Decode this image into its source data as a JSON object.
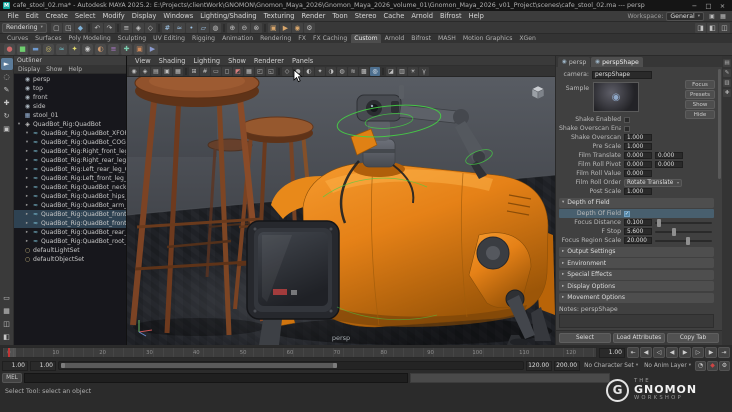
{
  "colors": {
    "accent": "#5285a6",
    "robot-orange": "#e58117",
    "control-green": "#45d145",
    "timeline-red": "#c03535"
  },
  "title_bar": {
    "title": "cafe_stool_02.ma* - Autodesk MAYA 2025.2: E:\\Projects\\clientWork\\GNOMON\\Gnomon_Maya_2026\\Gnomon_Maya_2026_volume_01\\Gnomon_Maya_2026_v01_Project\\scenes\\cafe_stool_02.ma --- persp",
    "maya_badge": "M",
    "minimize_glyph": "−",
    "maximize_glyph": "□",
    "close_glyph": "×"
  },
  "menu_bar": {
    "items": [
      "File",
      "Edit",
      "Create",
      "Select",
      "Modify",
      "Display",
      "Windows",
      "Lighting/Shading",
      "Texturing",
      "Render",
      "Toon",
      "Stereo",
      "Cache",
      "Arnold",
      "Bifrost",
      "Help"
    ],
    "workspace_label": "Workspace:",
    "workspace_value": "General",
    "caret": "▾",
    "right_icons": [
      {
        "name": "workspace-save-icon",
        "glyph": "▣"
      },
      {
        "name": "ui-layout-icon",
        "glyph": "▦"
      }
    ]
  },
  "status_line": {
    "menu_set": "Rendering",
    "caret": "▾",
    "icons": [
      {
        "name": "new-scene-icon",
        "glyph": "▢"
      },
      {
        "name": "open-scene-icon",
        "glyph": "◳"
      },
      {
        "name": "save-scene-icon",
        "glyph": "◆",
        "style": "color:#7fb2d9"
      },
      {
        "name": "status-divider",
        "glyph": "",
        "inter": "false",
        "style": "min-width:2px;width:2px;height:8px;background:#2d2d2d;border-radius:0;margin:0 1px"
      },
      {
        "name": "undo-icon",
        "glyph": "↶"
      },
      {
        "name": "redo-icon",
        "glyph": "↷"
      },
      {
        "name": "status-divider",
        "glyph": "",
        "inter": "false",
        "style": "min-width:2px;width:2px;height:8px;background:#2d2d2d;border-radius:0;margin:0 1px"
      },
      {
        "name": "select-hierarchy-icon",
        "glyph": "≡"
      },
      {
        "name": "select-object-icon",
        "glyph": "◈"
      },
      {
        "name": "select-component-icon",
        "glyph": "◇"
      },
      {
        "name": "status-divider",
        "glyph": "",
        "inter": "false",
        "style": "min-width:2px;width:2px;height:8px;background:#2d2d2d;border-radius:0;margin:0 1px"
      },
      {
        "name": "snap-grid-icon",
        "glyph": "#",
        "style": "color:#9fc5e8"
      },
      {
        "name": "snap-curve-icon",
        "glyph": "≈",
        "style": "color:#9fc5e8"
      },
      {
        "name": "snap-point-icon",
        "glyph": "•",
        "style": "color:#9fc5e8"
      },
      {
        "name": "snap-plane-icon",
        "glyph": "▱",
        "style": "color:#9fc5e8"
      },
      {
        "name": "make-live-icon",
        "glyph": "◍"
      },
      {
        "name": "status-divider",
        "glyph": "",
        "inter": "false",
        "style": "min-width:2px;width:2px;height:8px;background:#2d2d2d;border-radius:0;margin:0 1px"
      },
      {
        "name": "input-connections-icon",
        "glyph": "⊕"
      },
      {
        "name": "output-connections-icon",
        "glyph": "⊖"
      },
      {
        "name": "construction-history-icon",
        "glyph": "⊗"
      },
      {
        "name": "status-divider",
        "glyph": "",
        "inter": "false",
        "style": "min-width:2px;width:2px;height:8px;background:#2d2d2d;border-radius:0;margin:0 1px"
      },
      {
        "name": "render-view-icon",
        "glyph": "▣",
        "style": "color:#d9a66b"
      },
      {
        "name": "render-current-frame-icon",
        "glyph": "▶",
        "style": "color:#d9a66b"
      },
      {
        "name": "ipr-render-icon",
        "glyph": "◉",
        "style": "color:#d9a66b"
      },
      {
        "name": "render-settings-icon",
        "glyph": "⚙"
      }
    ],
    "right_icons": [
      {
        "name": "sidebar-attribute-editor-icon",
        "glyph": "◨"
      },
      {
        "name": "sidebar-tool-settings-icon",
        "glyph": "◧"
      },
      {
        "name": "sidebar-channel-box-icon",
        "glyph": "◫"
      }
    ]
  },
  "shelf": {
    "tabs": [
      {
        "label": "Curves"
      },
      {
        "label": "Surfaces"
      },
      {
        "label": "Poly Modeling"
      },
      {
        "label": "Sculpting"
      },
      {
        "label": "UV Editing"
      },
      {
        "label": "Rigging"
      },
      {
        "label": "Animation"
      },
      {
        "label": "Rendering"
      },
      {
        "label": "FX"
      },
      {
        "label": "FX Caching"
      },
      {
        "label": "Custom",
        "style": "background:#4d4d4d;color:#ececec"
      },
      {
        "label": "Arnold"
      },
      {
        "label": "Bifrost"
      },
      {
        "label": "MASH"
      },
      {
        "label": "Motion Graphics"
      },
      {
        "label": "XGen"
      }
    ],
    "icons": [
      {
        "name": "shelf-sphere-icon",
        "glyph": "●",
        "style": "color:#cf6a6a"
      },
      {
        "name": "shelf-cube-icon",
        "glyph": "■",
        "style": "color:#6ecf6e"
      },
      {
        "name": "shelf-plane-icon",
        "glyph": "▬",
        "style": "color:#6e9acf"
      },
      {
        "name": "shelf-torus-icon",
        "glyph": "◎",
        "style": "color:#cfc06e"
      },
      {
        "name": "shelf-curve-icon",
        "glyph": "≈",
        "style": "color:#6ec4cf"
      },
      {
        "name": "shelf-light-icon",
        "glyph": "✦",
        "style": "color:#e8e06e"
      },
      {
        "name": "shelf-camera-icon",
        "glyph": "◉",
        "style": "color:#c9c9c9"
      },
      {
        "name": "shelf-material-icon",
        "glyph": "◐",
        "style": "color:#cf9a6e"
      },
      {
        "name": "shelf-script-icon",
        "glyph": "≡",
        "style": "color:#b07acf"
      },
      {
        "name": "shelf-tool-icon",
        "glyph": "✚",
        "style": "color:#7acfb0"
      },
      {
        "name": "shelf-render-icon",
        "glyph": "▣",
        "style": "color:#cf8a5a"
      },
      {
        "name": "shelf-playblast-icon",
        "glyph": "▶",
        "style": "color:#8a9acf"
      }
    ]
  },
  "toolbox": {
    "tools": [
      {
        "name": "select-tool-icon",
        "glyph": "►",
        "style": "background:#5b7b99;color:#fff"
      },
      {
        "name": "lasso-tool-icon",
        "glyph": "◌"
      },
      {
        "name": "paint-select-tool-icon",
        "glyph": "✎"
      },
      {
        "name": "move-tool-icon",
        "glyph": "✚"
      },
      {
        "name": "rotate-tool-icon",
        "glyph": "↻"
      },
      {
        "name": "scale-tool-icon",
        "glyph": "▣"
      }
    ],
    "layouts": [
      {
        "name": "single-pane-layout-icon",
        "glyph": "▭"
      },
      {
        "name": "four-pane-layout-icon",
        "glyph": "▦"
      },
      {
        "name": "two-pane-layout-icon",
        "glyph": "◫"
      },
      {
        "name": "persp-outliner-layout-icon",
        "glyph": "◧"
      }
    ]
  },
  "outliner": {
    "title": "Outliner",
    "menus": [
      "Display",
      "Show",
      "Help"
    ],
    "items": [
      {
        "label": "persp",
        "arrow": "",
        "icon_glyph": "◉",
        "icon_style": "color:#aab4bd",
        "row_style": "padding-left:2px"
      },
      {
        "label": "top",
        "arrow": "",
        "icon_glyph": "◉",
        "icon_style": "color:#aab4bd",
        "row_style": "padding-left:2px"
      },
      {
        "label": "front",
        "arrow": "",
        "icon_glyph": "◉",
        "icon_style": "color:#aab4bd",
        "row_style": "padding-left:2px"
      },
      {
        "label": "side",
        "arrow": "",
        "icon_glyph": "◉",
        "icon_style": "color:#aab4bd",
        "row_style": "padding-left:2px"
      },
      {
        "label": "stool_01",
        "arrow": "",
        "icon_glyph": "▦",
        "icon_style": "color:#8fa8c9",
        "row_style": "padding-left:2px"
      },
      {
        "label": "QuadBot_Rig:QuadBot",
        "arrow": "▾",
        "icon_glyph": "◈",
        "icon_style": "color:#c9c9c9",
        "row_style": "padding-left:2px"
      },
      {
        "label": "QuadBot_Rig:QuadBot_XFORM_CTRL",
        "arrow": "▾",
        "icon_glyph": "≈",
        "icon_style": "color:#7fc4d9",
        "row_style": "padding-left:10px"
      },
      {
        "label": "QuadBot_Rig:QuadBot_COG_CTRL",
        "arrow": "▾",
        "icon_glyph": "≈",
        "icon_style": "color:#7fc4d9",
        "row_style": "padding-left:10px"
      },
      {
        "label": "QuadBot_Rig:Right_front_leg_CTRL",
        "arrow": "▸",
        "icon_glyph": "≈",
        "icon_style": "color:#7fc4d9",
        "row_style": "padding-left:10px"
      },
      {
        "label": "QuadBot_Rig:Right_rear_leg_CTRL",
        "arrow": "▸",
        "icon_glyph": "≈",
        "icon_style": "color:#7fc4d9",
        "row_style": "padding-left:10px"
      },
      {
        "label": "QuadBot_Rig:Left_rear_leg_CTRL",
        "arrow": "▸",
        "icon_glyph": "≈",
        "icon_style": "color:#7fc4d9",
        "row_style": "padding-left:10px"
      },
      {
        "label": "QuadBot_Rig:Left_front_leg_CTRL",
        "arrow": "▸",
        "icon_glyph": "≈",
        "icon_style": "color:#7fc4d9",
        "row_style": "padding-left:10px"
      },
      {
        "label": "QuadBot_Rig:QuadBot_neck_INT",
        "arrow": "▸",
        "icon_glyph": "≈",
        "icon_style": "color:#7fc4d9",
        "row_style": "padding-left:10px"
      },
      {
        "label": "QuadBot_Rig:QuadBot_hips_INT",
        "arrow": "▸",
        "icon_glyph": "≈",
        "icon_style": "color:#7fc4d9",
        "row_style": "padding-left:10px"
      },
      {
        "label": "QuadBot_Rig:QuadBot_arm_base_INT",
        "arrow": "▸",
        "icon_glyph": "≈",
        "icon_style": "color:#7fc4d9",
        "row_style": "padding-left:10px"
      },
      {
        "label": "QuadBot_Rig:QuadBot_front_R_shldr_INT",
        "arrow": "▸",
        "icon_glyph": "≈",
        "icon_style": "color:#7fc4d9",
        "row_style": "padding-left:10px;background:rgba(82,133,166,.4)"
      },
      {
        "label": "QuadBot_Rig:QuadBot_front_L_shldr_INT",
        "arrow": "▸",
        "icon_glyph": "≈",
        "icon_style": "color:#7fc4d9",
        "row_style": "padding-left:10px;background:rgba(82,133,166,.4)"
      },
      {
        "label": "QuadBot_Rig:QuadBot_rear_INT_plate",
        "arrow": "▸",
        "icon_glyph": "≈",
        "icon_style": "color:#7fc4d9",
        "row_style": "padding-left:10px"
      },
      {
        "label": "QuadBot_Rig:QuadBot_root_INT_grp",
        "arrow": "▸",
        "icon_glyph": "≈",
        "icon_style": "color:#7fc4d9",
        "row_style": "padding-left:10px"
      },
      {
        "label": "defaultLightSet",
        "arrow": "",
        "icon_glyph": "○",
        "icon_style": "color:#c9b87f",
        "row_style": "padding-left:2px"
      },
      {
        "label": "defaultObjectSet",
        "arrow": "",
        "icon_glyph": "○",
        "icon_style": "color:#c9b87f",
        "row_style": "padding-left:2px"
      }
    ]
  },
  "viewport": {
    "menus": [
      "View",
      "Shading",
      "Lighting",
      "Show",
      "Renderer",
      "Panels"
    ],
    "camera_label": "persp",
    "toolbar_icons": [
      {
        "name": "select-camera-icon",
        "glyph": "◉"
      },
      {
        "name": "lock-camera-icon",
        "glyph": "◈"
      },
      {
        "name": "camera-attributes-icon",
        "glyph": "▤"
      },
      {
        "name": "bookmarks-icon",
        "glyph": "▣"
      },
      {
        "name": "image-plane-icon",
        "glyph": "▦"
      },
      {
        "name": "toolbar-divider",
        "glyph": "",
        "inter": "false",
        "style": "min-width:2px;width:2px;height:7px;background:#2a2a2a;border-radius:0;margin:0 1px"
      },
      {
        "name": "2d-pan-zoom-icon",
        "glyph": "⊞"
      },
      {
        "name": "grid-icon",
        "glyph": "#"
      },
      {
        "name": "film-gate-icon",
        "glyph": "▭"
      },
      {
        "name": "resolution-gate-icon",
        "glyph": "◻"
      },
      {
        "name": "gate-mask-icon",
        "glyph": "◩",
        "style": "color:#d98080"
      },
      {
        "name": "field-chart-icon",
        "glyph": "▦"
      },
      {
        "name": "safe-action-icon",
        "glyph": "◰"
      },
      {
        "name": "safe-title-icon",
        "glyph": "◱"
      },
      {
        "name": "toolbar-divider",
        "glyph": "",
        "inter": "false",
        "style": "min-width:2px;width:2px;height:7px;background:#2a2a2a;border-radius:0;margin:0 1px"
      },
      {
        "name": "wireframe-icon",
        "glyph": "◇"
      },
      {
        "name": "shaded-icon",
        "glyph": "●"
      },
      {
        "name": "textured-icon",
        "glyph": "◐"
      },
      {
        "name": "use-all-lights-icon",
        "glyph": "✦"
      },
      {
        "name": "shadows-icon",
        "glyph": "◑"
      },
      {
        "name": "screen-space-ao-icon",
        "glyph": "◍"
      },
      {
        "name": "motion-blur-icon",
        "glyph": "≋"
      },
      {
        "name": "multisample-aa-icon",
        "glyph": "▩"
      },
      {
        "name": "depth-of-field-icon",
        "glyph": "◎",
        "style": "background:#4d6f8f;color:#fff"
      },
      {
        "name": "toolbar-divider",
        "glyph": "",
        "inter": "false",
        "style": "min-width:2px;width:2px;height:7px;background:#2a2a2a;border-radius:0;margin:0 1px"
      },
      {
        "name": "isolate-select-icon",
        "glyph": "◪"
      },
      {
        "name": "x-ray-icon",
        "glyph": "▥"
      },
      {
        "name": "exposure-icon",
        "glyph": "☀"
      },
      {
        "name": "gamma-icon",
        "glyph": "γ"
      }
    ]
  },
  "attribute_editor": {
    "tabs": [
      {
        "label": "persp",
        "icon": "◉"
      },
      {
        "label": "perspShape",
        "icon": "◉",
        "style": "background:#4f4f4f;color:#ececec"
      }
    ],
    "side_buttons": [
      "Focus",
      "Presets",
      "Show",
      "Hide"
    ],
    "camera_label": "camera:",
    "camera_value": "perspShape",
    "sample_label": "Sample",
    "sample_icon": "◉",
    "caret": "▾",
    "check_rows": [
      {
        "label": "Shake Enabled"
      },
      {
        "label": "Shake Overscan Enabled"
      }
    ],
    "value_rows": [
      {
        "label": "Shake Overscan",
        "v1": "1.000",
        "v2_style": "display:none"
      },
      {
        "label": "Pre Scale",
        "v1": "1.000",
        "v2_style": "display:none"
      },
      {
        "label": "Film Translate",
        "v1": "0.000",
        "v2": "0.000"
      },
      {
        "label": "Film Roll Pivot",
        "v1": "0.000",
        "v2": "0.000"
      },
      {
        "label": "Film Roll Value",
        "v1": "0.000",
        "v2_style": "display:none"
      }
    ],
    "film_roll_order_label": "Film Roll Order",
    "film_roll_order_value": "Rotate Translate",
    "post_scale_label": "Post Scale",
    "post_scale_value": "1.000",
    "dof": {
      "section_arrow": "▾",
      "section_title": "Depth of Field",
      "check_glyph": "✓",
      "checkbox_label": "Depth Of Field",
      "slider_rows": [
        {
          "label": "Focus Distance",
          "value": "0.100",
          "thumb_style": "left:3%"
        },
        {
          "label": "F Stop",
          "value": "5.600",
          "thumb_style": "left:30%"
        },
        {
          "label": "Focus Region Scale",
          "value": "20.000",
          "thumb_style": "left:55%"
        }
      ]
    },
    "collapsed_sections": [
      {
        "arrow": "▸",
        "label": "Output Settings"
      },
      {
        "arrow": "▸",
        "label": "Environment"
      },
      {
        "arrow": "▸",
        "label": "Special Effects"
      },
      {
        "arrow": "▸",
        "label": "Display Options"
      },
      {
        "arrow": "▸",
        "label": "Movement Options"
      }
    ],
    "notes_label": "Notes: perspShape",
    "buttons": {
      "select": "Select",
      "load": "Load Attributes",
      "copy": "Copy Tab"
    }
  },
  "right_strip": {
    "icons": [
      {
        "name": "attribute-editor-tab-icon",
        "glyph": "▤"
      },
      {
        "name": "tool-settings-tab-icon",
        "glyph": "✎"
      },
      {
        "name": "channel-box-tab-icon",
        "glyph": "▥"
      },
      {
        "name": "modeling-toolkit-tab-icon",
        "glyph": "✚"
      }
    ]
  },
  "timeline": {
    "current_frame": "1.00",
    "tick_labels": [
      {
        "label": "0",
        "style": "left:1%"
      },
      {
        "label": "10",
        "style": "left:8.9%"
      },
      {
        "label": "20",
        "style": "left:16.8%"
      },
      {
        "label": "30",
        "style": "left:24.7%"
      },
      {
        "label": "40",
        "style": "left:32.6%"
      },
      {
        "label": "50",
        "style": "left:40.5%"
      },
      {
        "label": "60",
        "style": "left:48.4%"
      },
      {
        "label": "70",
        "style": "left:56.3%"
      },
      {
        "label": "80",
        "style": "left:64.2%"
      },
      {
        "label": "90",
        "style": "left:72.1%"
      },
      {
        "label": "100",
        "style": "left:80%"
      },
      {
        "label": "110",
        "style": "left:87.9%"
      },
      {
        "label": "120",
        "style": "left:95.8%"
      }
    ],
    "playback": [
      {
        "name": "go-to-start-button",
        "glyph": "⇤"
      },
      {
        "name": "step-back-frame-button",
        "glyph": "◀"
      },
      {
        "name": "step-back-key-button",
        "glyph": "◁"
      },
      {
        "name": "play-backwards-button",
        "glyph": "◀"
      },
      {
        "name": "play-forwards-button",
        "glyph": "▶"
      },
      {
        "name": "step-forward-key-button",
        "glyph": "▷"
      },
      {
        "name": "step-forward-frame-button",
        "glyph": "▶"
      },
      {
        "name": "go-to-end-button",
        "glyph": "⇥"
      }
    ]
  },
  "range_slider": {
    "animation_start": "1.00",
    "playback_start": "1.00",
    "playback_end": "120.00",
    "animation_end": "200.00",
    "character_set": "No Character Set",
    "anim_layer": "No Anim Layer",
    "caret": "▾",
    "icons": [
      {
        "name": "playback-options-icon",
        "glyph": "◔"
      },
      {
        "name": "auto-keyframe-icon",
        "glyph": "◆",
        "style": "color:#cc4444"
      },
      {
        "name": "animation-preferences-icon",
        "glyph": "⚙"
      }
    ]
  },
  "command_line": {
    "mel_label": "MEL",
    "input_value": "",
    "help_text": "Select Tool: select an object"
  },
  "logo": {
    "mark": "G",
    "the": "THE",
    "gnomon": "GNOMON",
    "workshop": "WORKSHOP"
  }
}
